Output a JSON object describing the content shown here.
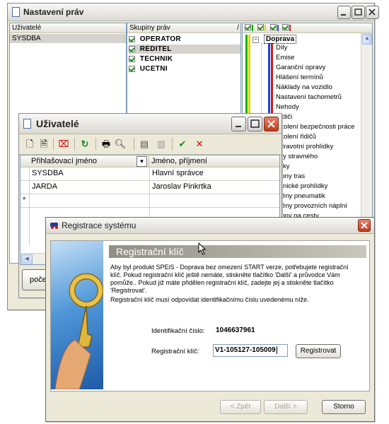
{
  "nastaveni_window": {
    "title": "Nastavení práv",
    "users_header": "Uživatelé",
    "users": [
      "SYSDBA"
    ],
    "groups_header": "Skupiny práv",
    "groups": [
      "OPERATOR",
      "REDITEL",
      "TECHNIK",
      "UCETNI"
    ],
    "tree_root": "Doprava",
    "tree_items": [
      "Díly",
      "Emise",
      "Garanční opravy",
      "Hlášení termínů",
      "Náklady na vozidlo",
      "Nastavení tachometrů",
      "Nehody",
      "Řidiči",
      "Školení bezpečnosti práce",
      "Školení řidičů",
      "Zdravotní prohlídky"
    ],
    "tree_items_partial": [
      "zby stravného",
      "azky",
      "blony tras",
      "chnické prohlídky",
      "měny pneumatik",
      "měny provozních náplní",
      "hlony na cesty"
    ],
    "bottom_text": "počet"
  },
  "uzivatele_window": {
    "title": "Uživatelé",
    "columns": [
      "Přihlašovací jméno",
      "Jméno, příjmení"
    ],
    "rows": [
      {
        "login": "SYSDBA",
        "name": "Hlavní správce"
      },
      {
        "login": "JARDA",
        "name": "Jaroslav Pinkrtka"
      }
    ],
    "new_row_marker": "*"
  },
  "registrace_window": {
    "title": "Registrace systému",
    "heading": "Registrační klíč",
    "paragraph1": "Aby byl produkt SPEiS - Doprava bez omezení START verze, potřebujete registrační klíč. Pokud registrační klíč ještě nemáte, stiskněte tlačítko 'Další' a průvodce Vám pomůže.. Pokud již máte přidělen registrační klíč, zadejte jej a stiskněte tlačítko 'Registrovat'.",
    "paragraph2": "Registrační klíč musí odpovídat identifikačnímu číslu uvedenému níže.",
    "id_label": "Identifikační číslo:",
    "id_value": "1046637961",
    "key_label": "Registrační klíč:",
    "key_value": "V1-105127-105009",
    "register_button": "Registrovat",
    "back_button": "< Zpět",
    "next_button": "Další >",
    "cancel_button": "Storno"
  },
  "colors": {
    "xp_blue_title": "#0a5ee0",
    "gray_title": "#dcdad2",
    "close_red": "#c1391c"
  }
}
